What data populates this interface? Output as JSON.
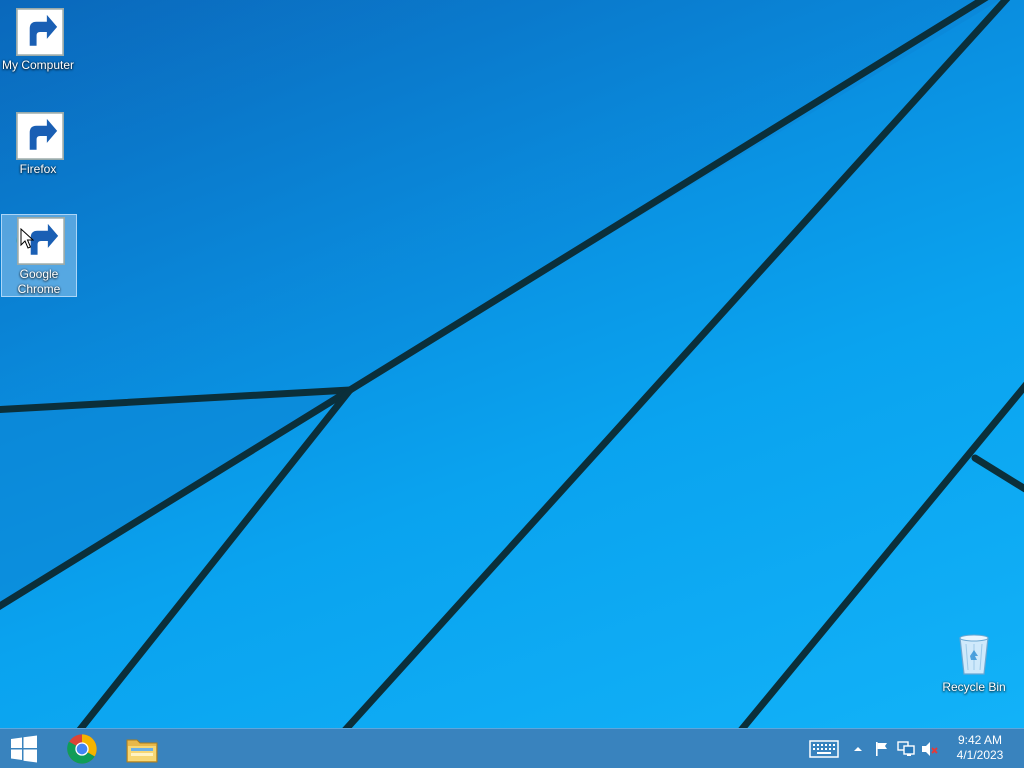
{
  "desktop": {
    "icons": [
      {
        "label": "My Computer",
        "icon": "computer-icon"
      },
      {
        "label": "Firefox",
        "icon": "firefox-icon"
      },
      {
        "label": "Google Chrome",
        "icon": "chrome-icon",
        "selected": true
      },
      {
        "label": "Recycle Bin",
        "icon": "recycle-bin-icon"
      }
    ]
  },
  "taskbar": {
    "start_icon": "windows-logo-icon",
    "pinned": [
      {
        "icon": "chrome-icon"
      },
      {
        "icon": "file-explorer-icon"
      }
    ],
    "tray": [
      "keyboard-icon",
      "chevron-up-icon",
      "action-center-flag-icon",
      "network-icon",
      "volume-muted-icon"
    ],
    "clock": {
      "time": "9:42 AM",
      "date": "4/1/2023"
    }
  },
  "colors": {
    "wallpaper_blue": "#0a9ae8",
    "taskbar": "#2878b9",
    "selection": "#b4d7f5"
  }
}
